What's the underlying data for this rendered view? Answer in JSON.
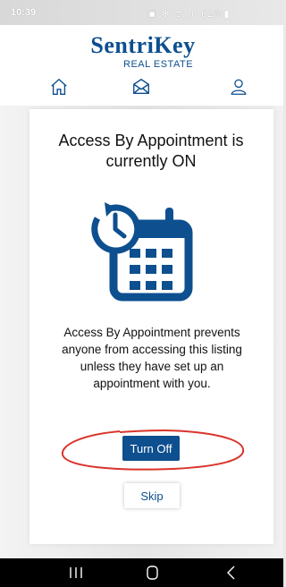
{
  "status_bar": {
    "time": "10:39",
    "icons_text": "▣ ✻ ᯤ .ıl 62%▮",
    "battery": "62%"
  },
  "header": {
    "logo": "SentriKey",
    "logo_sub": "REAL ESTATE",
    "nav_icons": [
      "home-icon",
      "mail-icon",
      "user-icon"
    ],
    "brand_color": "#0d4f8f"
  },
  "card": {
    "title": "Access By Appointment is currently ON",
    "description": "Access By Appointment prevents anyone from accessing this listing unless they have set up an appointment with you.",
    "turn_off_label": "Turn Off",
    "skip_label": "Skip",
    "annotation_color": "#d9342b"
  },
  "system_nav": {
    "icons": [
      "recent-apps-icon",
      "home-button-icon",
      "back-icon"
    ]
  }
}
